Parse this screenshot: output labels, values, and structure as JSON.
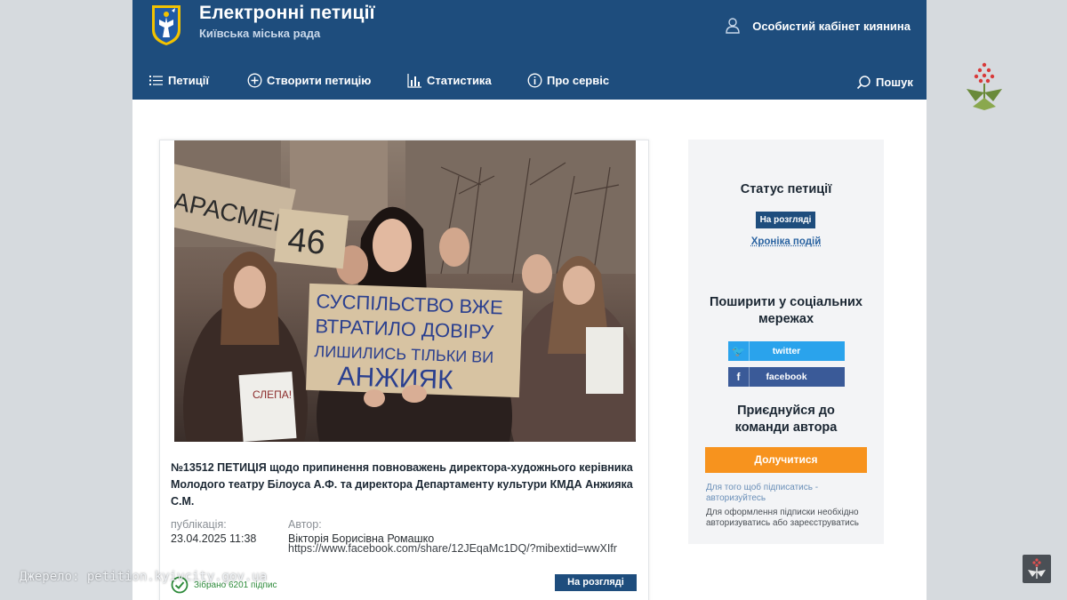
{
  "header": {
    "title": "Електронні петиції",
    "subtitle": "Київська міська рада",
    "cabinet_label": "Особистий кабінет киянина"
  },
  "nav": {
    "items": [
      {
        "label": "Петиції",
        "icon": "list-icon"
      },
      {
        "label": "Створити петицію",
        "icon": "plus-circle-icon"
      },
      {
        "label": "Статистика",
        "icon": "bar-chart-icon"
      },
      {
        "label": "Про сервіс",
        "icon": "info-icon"
      }
    ],
    "search_label": "Пошук"
  },
  "photo": {
    "sign_main_lines": [
      "СУСПІЛЬСТВО ВЖЕ",
      "ВТРАТИЛО ДОВІРУ",
      "ЛИШИЛИСЬ ТІЛЬКИ ВИ",
      "АНЖИЯК"
    ],
    "sign_number": "46",
    "sign_left": "АРАСМЕНТ НЕ",
    "sign_small": "СЛЕПА!"
  },
  "petition": {
    "title": "№13512 ПЕТИЦІЯ щодо припинення повноважень директора-художнього керівника Молодого театру Білоуса А.Ф. та директора Департаменту культури КМДА Анжияка С.М.",
    "publication_label": "публікація:",
    "publication_date": "23.04.2025 11:38",
    "author_label": "Автор:",
    "author_name": "Вікторія Борисівна Ромашко",
    "author_link": "https://www.facebook.com/share/12JEqaMc1DQ/?mibextid=wwXIfr",
    "collected_text": "Зібрано 6201 підпис",
    "status": "На розгляді"
  },
  "sidebar": {
    "status_heading": "Статус петиції",
    "status_value": "На розгляді",
    "chronicle_link": "Хроніка подій",
    "share_heading": "Поширити у соціальних мережах",
    "twitter_label": "twitter",
    "facebook_label": "facebook",
    "join_heading": "Приєднуйся до команди автора",
    "join_button": "Долучитися",
    "hint_link": "Для того щоб підписатись - авторизуйтесь",
    "hint_text": "Для оформлення підписки необхідно авторизуватись або зареєструватись"
  },
  "overlay": {
    "source": "Джерело: petition.kyivcity.gov.ua"
  },
  "colors": {
    "header_bg": "#1e4d7d",
    "join_orange": "#f7931e",
    "twitter_blue": "#2aa3ec",
    "facebook_blue": "#3a5a98",
    "collected_green": "#2e8b3b"
  }
}
